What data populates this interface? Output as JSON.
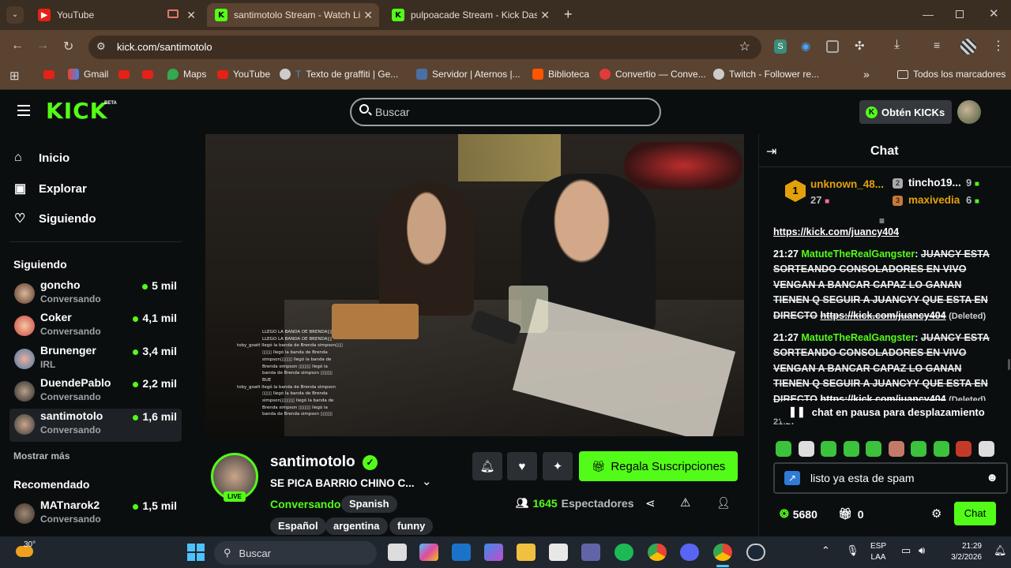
{
  "browser": {
    "tabs": [
      {
        "label": "YouTube",
        "icon": "youtube-icon"
      },
      {
        "label": "santimotolo Stream - Watch Liv",
        "icon": "kick-icon"
      },
      {
        "label": "pulpoacade Stream - Kick Dash",
        "icon": "kick-icon"
      }
    ],
    "url": "kick.com/santimotolo",
    "bookmarks": [
      "Gmail",
      "Maps",
      "YouTube",
      "Texto de graffiti | Ge...",
      "Servidor | Aternos |...",
      "Biblioteca",
      "Convertio — Conve...",
      "Twitch - Follower re..."
    ],
    "all_bookmarks": "Todos los marcadores",
    "more_bookmarks": "»"
  },
  "kick": {
    "logo": "KICK",
    "logo_beta": "BETA",
    "search_placeholder": "Buscar",
    "get_kicks": "Obtén KICKs",
    "nav": [
      "Inicio",
      "Explorar",
      "Siguiendo"
    ],
    "following_title": "Siguiendo",
    "following": [
      {
        "name": "goncho",
        "category": "Conversando",
        "viewers": "5 mil"
      },
      {
        "name": "Coker",
        "category": "Conversando",
        "viewers": "4,1 mil"
      },
      {
        "name": "Brunenger",
        "category": "IRL",
        "viewers": "3,4 mil"
      },
      {
        "name": "DuendePablo",
        "category": "Conversando",
        "viewers": "2,2 mil"
      },
      {
        "name": "santimotolo",
        "category": "Conversando",
        "viewers": "1,6 mil"
      }
    ],
    "show_more": "Mostrar más",
    "recommended_title": "Recomendado",
    "recommended": [
      {
        "name": "MATnarok2",
        "category": "Conversando",
        "viewers": "1,5 mil"
      }
    ]
  },
  "stream": {
    "channel": "santimotolo",
    "title": "SE PICA BARRIO CHINO C...",
    "live_badge": "LIVE",
    "category": "Conversando",
    "language": "Spanish",
    "tags": [
      "Español",
      "argentina",
      "funny"
    ],
    "viewers": "1645",
    "viewers_label": "Espectadores",
    "gift_subs": "Regala Suscripciones",
    "overlay_lines": [
      "LLEGO LA BANDA DE BRENDA▯▯",
      "LLEGO LA BANDA DE BRENDA▯▯",
      "toby_goatt  llegó la banda de Brenda simpson▯▯▯",
      "▯▯▯▯ llegó la banda de Brenda",
      "simpson▯▯▯▯▯ llegó la banda de",
      "Brenda simpson ▯▯▯▯▯ llegó la",
      "banda de Brenda simpson ▯▯▯▯▯",
      "BUE",
      "toby_goatt  llegó la banda de Brenda simpson",
      "▯▯▯▯ llegó la banda de Brenda",
      "simpson▯▯▯▯▯▯ llegó la banda de",
      "Brenda simpson ▯▯▯▯▯ llegó la",
      "banda de Brenda simpson ▯▯▯▯▯"
    ]
  },
  "chat": {
    "title": "Chat",
    "leaderboard": [
      {
        "rank": "1",
        "name": "unknown_48...",
        "count": "27"
      },
      {
        "rank": "2",
        "name": "tincho19...",
        "count": "9"
      },
      {
        "rank": "3",
        "name": "maxivedia",
        "count": "6"
      }
    ],
    "link_partial": "https://kick.com/juancy404",
    "messages": [
      {
        "time": "21:27",
        "user": "MatuteTheRealGangster",
        "text": "JUANCY ESTA SORTEANDO CONSOLADORES EN VIVO VENGAN A BANCAR CAPAZ LO GANAN TIENEN Q SEGUIR A JUANCYY QUE ESTA EN DIRECTO",
        "link": "https://kick.com/juancy404",
        "note": "(Deleted)"
      },
      {
        "time": "21:27",
        "user": "MatuteTheRealGangster",
        "text": "JUANCY ESTA SORTEANDO CONSOLADORES EN VIVO VENGAN A BANCAR CAPAZ LO GANAN TIENEN Q SEGUIR A JUANCYY QUE ESTA EN DIRECTO",
        "link": "https://kick.com/juancy404",
        "note": "(Deleted)"
      }
    ],
    "partial_time": "21:27",
    "paused": "chat en pausa para desplazamiento",
    "input_value": "listo ya esta de spam",
    "points": "5680",
    "subs": "0",
    "send": "Chat"
  },
  "taskbar": {
    "temp": "30°",
    "search": "Buscar",
    "lang1": "ESP",
    "lang2": "LAA",
    "time": "21:29",
    "date": "3/2/2026"
  },
  "colors": {
    "kick_green": "#53fc18",
    "browser_brown": "#5a4330",
    "bg": "#0b0e0f"
  }
}
